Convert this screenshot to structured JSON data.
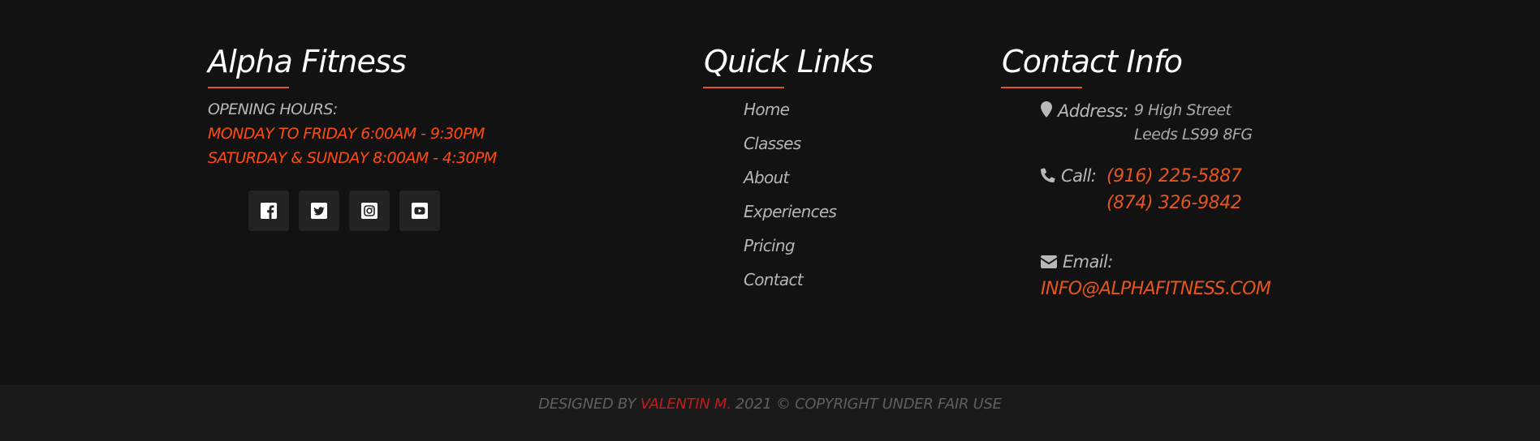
{
  "about": {
    "title": "Alpha Fitness",
    "hours_label": "OPENING HOURS:",
    "hours": [
      "MONDAY TO FRIDAY 6:00AM - 9:30PM",
      "SATURDAY & SUNDAY 8:00AM - 4:30PM"
    ],
    "social": [
      {
        "icon": "facebook-icon"
      },
      {
        "icon": "twitter-icon"
      },
      {
        "icon": "instagram-icon"
      },
      {
        "icon": "youtube-icon"
      }
    ]
  },
  "quick_links": {
    "title": "Quick Links",
    "items": [
      "Home",
      "Classes",
      "About",
      "Experiences",
      "Pricing",
      "Contact"
    ]
  },
  "contact": {
    "title": "Contact Info",
    "address_label": "Address:",
    "address_lines": [
      "9 High Street",
      "Leeds LS99 8FG"
    ],
    "call_label": "Call:",
    "phones": [
      "(916) 225-5887",
      "(874) 326-9842"
    ],
    "email_label": "Email:",
    "email": "INFO@ALPHAFITNESS.COM"
  },
  "footer": {
    "prefix": "DESIGNED BY ",
    "designer": "VALENTIN M.",
    "suffix": " 2021 © COPYRIGHT UNDER FAIR USE"
  },
  "colors": {
    "background": "#121212",
    "bottom_bar": "#1a1a1a",
    "accent": "#e4551f",
    "hours_accent": "#ff4a12",
    "designer": "#c41a1a",
    "social_button": "#232323"
  }
}
